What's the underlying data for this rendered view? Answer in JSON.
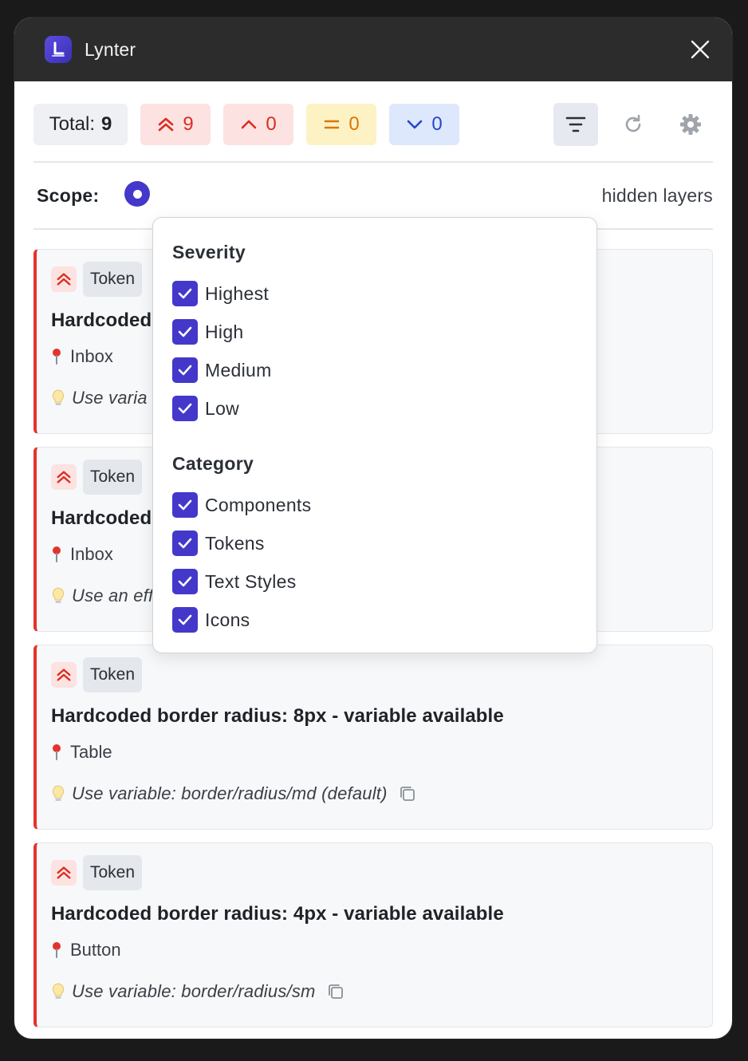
{
  "window": {
    "title": "Lynter"
  },
  "toolbar": {
    "total_label": "Total:",
    "total_count": "9",
    "highest_count": "9",
    "high_count": "0",
    "medium_count": "0",
    "low_count": "0"
  },
  "scope": {
    "label": "Scope:",
    "hidden_layers_text": "hidden layers"
  },
  "filter_menu": {
    "severity_heading": "Severity",
    "severity_options": [
      "Highest",
      "High",
      "Medium",
      "Low"
    ],
    "category_heading": "Category",
    "category_options": [
      "Components",
      "Tokens",
      "Text Styles",
      "Icons"
    ]
  },
  "issues": [
    {
      "badge": "Token",
      "title": "Hardcoded",
      "location": "Inbox",
      "hint": "Use varia"
    },
    {
      "badge": "Token",
      "title": "Hardcoded",
      "location": "Inbox",
      "hint": "Use an effect variable from our foundations"
    },
    {
      "badge": "Token",
      "title": "Hardcoded border radius: 8px - variable available",
      "location": "Table",
      "hint": "Use variable: border/radius/md (default)"
    },
    {
      "badge": "Token",
      "title": "Hardcoded border radius: 4px - variable available",
      "location": "Button",
      "hint": "Use variable: border/radius/sm"
    }
  ],
  "colors": {
    "accent": "#4338ca",
    "severity_highest": "#e5322d",
    "severity_medium": "#d97706",
    "severity_low": "#2548c8"
  }
}
